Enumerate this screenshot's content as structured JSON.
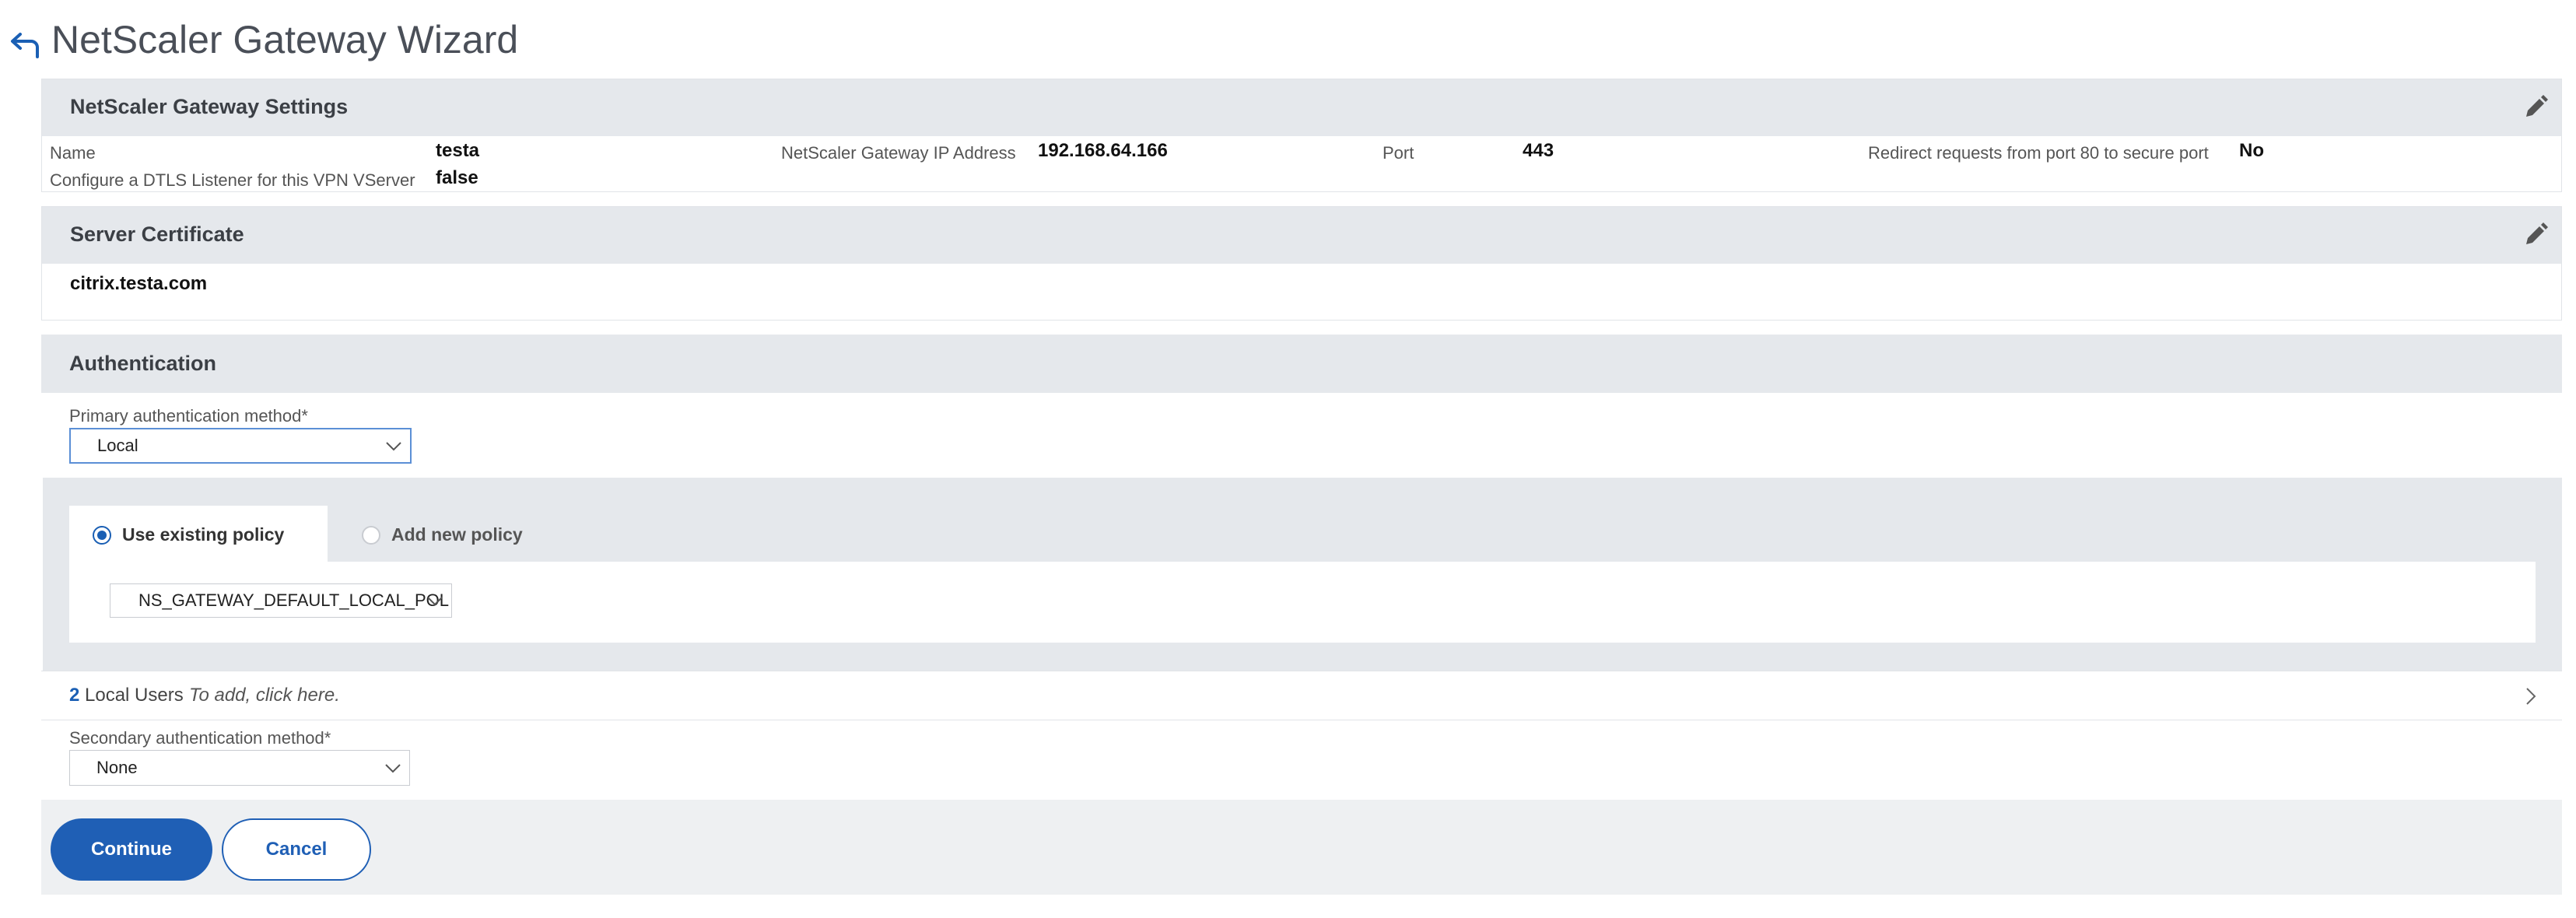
{
  "header": {
    "title": "NetScaler Gateway Wizard",
    "back_icon": "back-arrow-icon"
  },
  "gateway_settings": {
    "title": "NetScaler Gateway Settings",
    "edit_icon": "pencil-icon",
    "fields": {
      "name_label": "Name",
      "name_value": "testa",
      "ip_label": "NetScaler Gateway IP Address",
      "ip_value": "192.168.64.166",
      "port_label": "Port",
      "port_value": "443",
      "redirect_label": "Redirect requests from port 80 to secure port",
      "redirect_value": "No",
      "dtls_label": "Configure a DTLS Listener for this VPN VServer",
      "dtls_value": "false"
    }
  },
  "server_certificate": {
    "title": "Server Certificate",
    "edit_icon": "pencil-icon",
    "value": "citrix.testa.com"
  },
  "authentication": {
    "title": "Authentication",
    "primary_label": "Primary authentication method*",
    "primary_value": "Local",
    "tabs": [
      {
        "label": "Use existing policy",
        "selected": true
      },
      {
        "label": "Add new policy",
        "selected": false
      }
    ],
    "policy_value": "NS_GATEWAY_DEFAULT_LOCAL_POL",
    "local_users": {
      "count": "2",
      "label": "Local Users",
      "hint": "To add, click here."
    },
    "secondary_label": "Secondary authentication method*",
    "secondary_value": "None"
  },
  "footer": {
    "continue_label": "Continue",
    "cancel_label": "Cancel"
  },
  "colors": {
    "accent": "#1f5fb5",
    "panel_header": "#e5e8ec",
    "footer_bg": "#eef0f2"
  }
}
